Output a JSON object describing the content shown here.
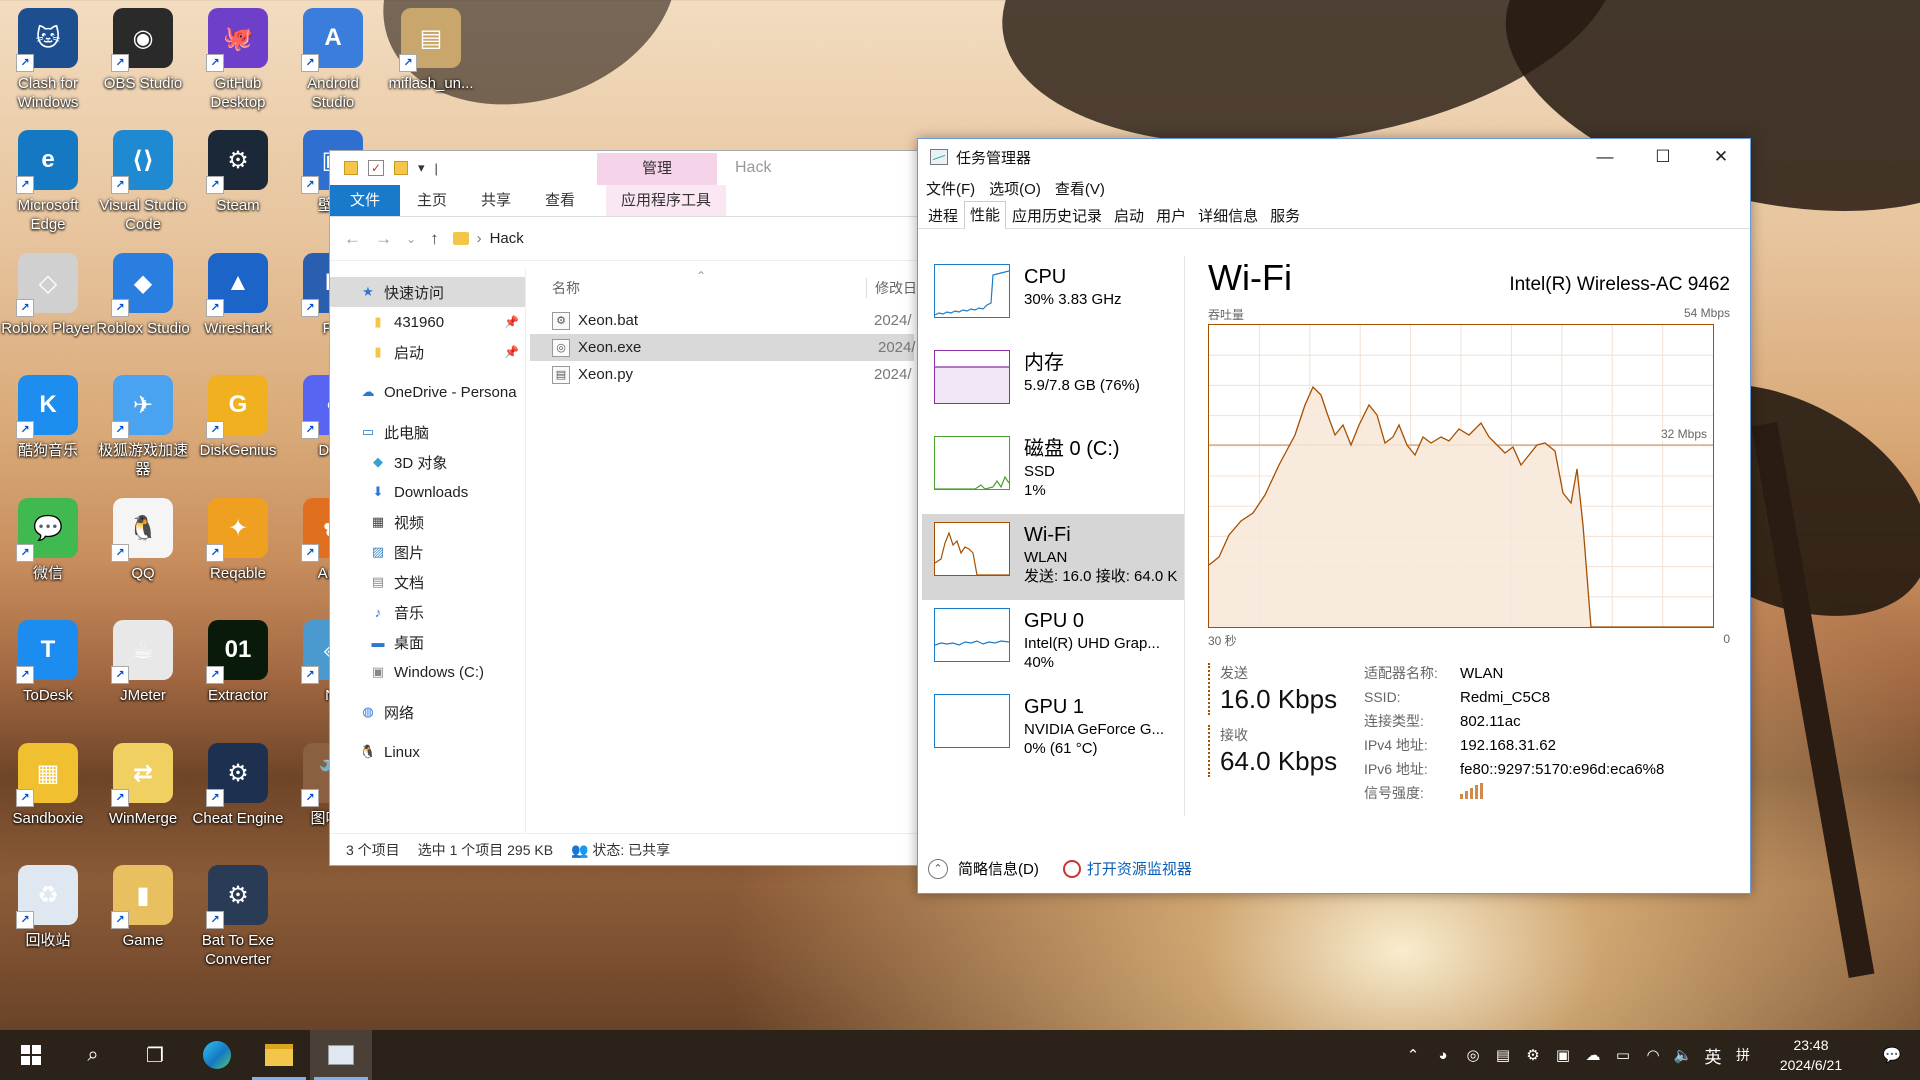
{
  "desktop": {
    "icons": [
      {
        "label": "Clash for Windows",
        "color": "#1d4e8f",
        "glyph": "🐱"
      },
      {
        "label": "OBS Studio",
        "color": "#2a2a2a",
        "glyph": "◉"
      },
      {
        "label": "GitHub Desktop",
        "color": "#6e40c9",
        "glyph": "🐙"
      },
      {
        "label": "Android Studio",
        "color": "#3b7ddd",
        "glyph": "A"
      },
      {
        "label": "miflash_un...",
        "color": "#c9a66b",
        "glyph": "▤"
      },
      {
        "label": "Microsoft Edge",
        "color": "#1479c2",
        "glyph": "e"
      },
      {
        "label": "Visual Studio Code",
        "color": "#1f8ad2",
        "glyph": "⟨⟩"
      },
      {
        "label": "Steam",
        "color": "#1b2838",
        "glyph": "⚙"
      },
      {
        "label": "壁纸",
        "color": "#2e6fd0",
        "glyph": "▣"
      },
      {
        "label": "Roblox Player",
        "color": "#d0d0d0",
        "glyph": "◇"
      },
      {
        "label": "Roblox Studio",
        "color": "#2a7ee0",
        "glyph": "◆"
      },
      {
        "label": "Wireshark",
        "color": "#1c64c8",
        "glyph": "▲"
      },
      {
        "label": "PC",
        "color": "#2a5fb0",
        "glyph": "P"
      },
      {
        "label": "酷狗音乐",
        "color": "#1d8ef0",
        "glyph": "K"
      },
      {
        "label": "极狐游戏加速器",
        "color": "#4aa3f0",
        "glyph": "✈"
      },
      {
        "label": "DiskGenius",
        "color": "#f0b020",
        "glyph": "G"
      },
      {
        "label": "Disc",
        "color": "#5865f2",
        "glyph": "◐"
      },
      {
        "label": "微信",
        "color": "#3fb950",
        "glyph": "💬"
      },
      {
        "label": "QQ",
        "color": "#f5f5f5",
        "glyph": "🐧"
      },
      {
        "label": "Reqable",
        "color": "#f0a020",
        "glyph": "✦"
      },
      {
        "label": "Autu",
        "color": "#e07020",
        "glyph": "✿"
      },
      {
        "label": "ToDesk",
        "color": "#1c8cf0",
        "glyph": "T"
      },
      {
        "label": "JMeter",
        "color": "#e8e8e8",
        "glyph": "☕"
      },
      {
        "label": "Extractor",
        "color": "#0a1a0a",
        "glyph": "01"
      },
      {
        "label": "Nr",
        "color": "#4a9ad0",
        "glyph": "◈"
      },
      {
        "label": "Sandboxie",
        "color": "#f0c030",
        "glyph": "▦"
      },
      {
        "label": "WinMerge",
        "color": "#f0d060",
        "glyph": "⇄"
      },
      {
        "label": "Cheat Engine",
        "color": "#1d3050",
        "glyph": "⚙"
      },
      {
        "label": "图吧工",
        "color": "#8a6040",
        "glyph": "🔧"
      },
      {
        "label": "回收站",
        "color": "#dfe8f0",
        "glyph": "♻"
      },
      {
        "label": "Game",
        "color": "#e8c060",
        "glyph": "▮"
      },
      {
        "label": "Bat To Exe Converter",
        "color": "#2a3b55",
        "glyph": "⚙"
      }
    ]
  },
  "explorer": {
    "context_header": "管理",
    "title": "Hack",
    "ribbon_tabs": [
      "文件",
      "主页",
      "共享",
      "查看",
      "应用程序工具"
    ],
    "address_path": "Hack",
    "nav": [
      {
        "label": "快速访问",
        "icon": "star-icon"
      },
      {
        "label": "431960",
        "icon": "folder-icon",
        "pinned": true
      },
      {
        "label": "启动",
        "icon": "folder-icon",
        "pinned": true
      },
      {
        "label": "OneDrive - Persona",
        "icon": "cloud-icon"
      },
      {
        "label": "此电脑",
        "icon": "pc-icon"
      },
      {
        "label": "3D 对象",
        "icon": "cube-icon"
      },
      {
        "label": "Downloads",
        "icon": "download-icon"
      },
      {
        "label": "视频",
        "icon": "video-icon"
      },
      {
        "label": "图片",
        "icon": "picture-icon"
      },
      {
        "label": "文档",
        "icon": "document-icon"
      },
      {
        "label": "音乐",
        "icon": "music-icon"
      },
      {
        "label": "桌面",
        "icon": "desktop-icon"
      },
      {
        "label": "Windows (C:)",
        "icon": "drive-icon"
      },
      {
        "label": "网络",
        "icon": "network-icon"
      },
      {
        "label": "Linux",
        "icon": "linux-icon"
      }
    ],
    "columns": {
      "name": "名称",
      "modified": "修改日"
    },
    "files": [
      {
        "name": "Xeon.bat",
        "date": "2024/",
        "selected": false
      },
      {
        "name": "Xeon.exe",
        "date": "2024/",
        "selected": true
      },
      {
        "name": "Xeon.py",
        "date": "2024/",
        "selected": false
      }
    ],
    "status": {
      "count": "3 个项目",
      "selection": "选中 1 个项目  295 KB",
      "share": "状态: 已共享"
    }
  },
  "taskmgr": {
    "title": "任务管理器",
    "menu": [
      "文件(F)",
      "选项(O)",
      "查看(V)"
    ],
    "tabs": [
      "进程",
      "性能",
      "应用历史记录",
      "启动",
      "用户",
      "详细信息",
      "服务"
    ],
    "selected_tab": "性能",
    "perf_items": [
      {
        "name": "CPU",
        "line1": "30% 3.83 GHz",
        "line2": "",
        "line3": "",
        "color": "#1a7bc9"
      },
      {
        "name": "内存",
        "line1": "5.9/7.8 GB (76%)",
        "line2": "",
        "line3": "",
        "color": "#8b2fa6"
      },
      {
        "name": "磁盘 0 (C:)",
        "line1": "SSD",
        "line2": "1%",
        "line3": "",
        "color": "#4aa02c"
      },
      {
        "name": "Wi-Fi",
        "line1": "WLAN",
        "line2": "发送: 16.0 接收: 64.0 K",
        "line3": "",
        "color": "#a74f01"
      },
      {
        "name": "GPU 0",
        "line1": "Intel(R) UHD Grap...",
        "line2": "40%",
        "line3": "",
        "color": "#1a7bc9"
      },
      {
        "name": "GPU 1",
        "line1": "NVIDIA GeForce G...",
        "line2": "0% (61 °C)",
        "line3": "",
        "color": "#1a7bc9"
      }
    ],
    "detail": {
      "heading": "Wi-Fi",
      "adapter": "Intel(R) Wireless-AC 9462",
      "throughput_label": "吞吐量",
      "max_label": "54 Mbps",
      "mid_label": "32 Mbps",
      "time_left": "30 秒",
      "time_right": "0",
      "send_label": "发送",
      "send_value": "16.0 Kbps",
      "recv_label": "接收",
      "recv_value": "64.0 Kbps",
      "props": [
        {
          "k": "适配器名称:",
          "v": "WLAN"
        },
        {
          "k": "SSID:",
          "v": "Redmi_C5C8"
        },
        {
          "k": "连接类型:",
          "v": "802.11ac"
        },
        {
          "k": "IPv4 地址:",
          "v": "192.168.31.62"
        },
        {
          "k": "IPv6 地址:",
          "v": "fe80::9297:5170:e96d:eca6%8"
        },
        {
          "k": "信号强度:",
          "v": ""
        }
      ]
    },
    "footer": {
      "summary": "简略信息(D)",
      "resmon": "打开资源监视器"
    }
  },
  "taskbar": {
    "time": "23:48",
    "date": "2024/6/21",
    "ime": "英",
    "ime2": "拼"
  }
}
